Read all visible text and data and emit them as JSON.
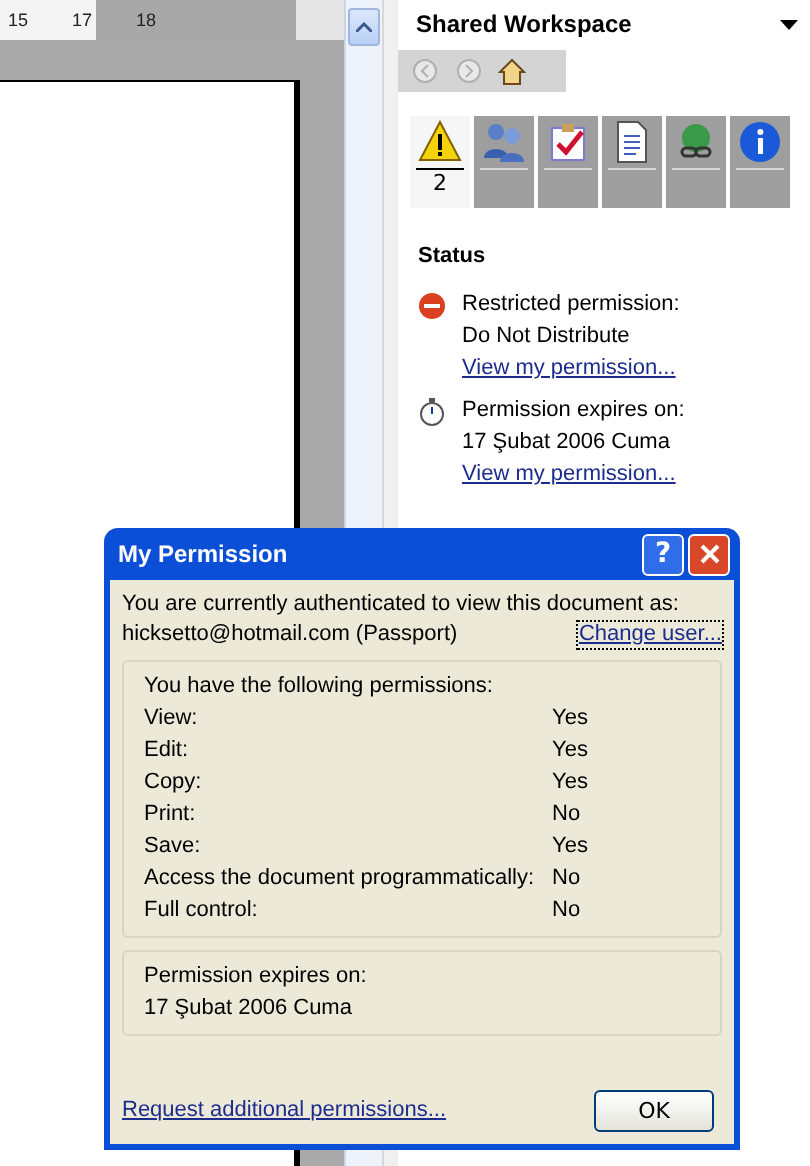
{
  "document": {
    "ruler_labels": [
      "15",
      "17",
      "18"
    ]
  },
  "task_pane": {
    "title": "Shared Workspace",
    "nav_buttons": [
      {
        "kind": "back",
        "disabled": true
      },
      {
        "kind": "forward",
        "disabled": true
      },
      {
        "kind": "home",
        "disabled": false
      }
    ],
    "tabs": [
      {
        "kind": "status",
        "badge": "2",
        "selected": true
      },
      {
        "kind": "members",
        "selected": false
      },
      {
        "kind": "tasks",
        "selected": false
      },
      {
        "kind": "documents",
        "selected": false
      },
      {
        "kind": "links",
        "selected": false
      },
      {
        "kind": "info",
        "selected": false
      }
    ],
    "section_title": "Status",
    "status_items": [
      {
        "kind": "restricted",
        "lines": [
          "Restricted permission:",
          "Do Not Distribute"
        ],
        "link": "View my permission..."
      },
      {
        "kind": "expiry",
        "lines": [
          "Permission expires on:",
          "17 Şubat 2006 Cuma"
        ],
        "link": "View my permission..."
      }
    ]
  },
  "dialog": {
    "title": "My Permission",
    "help": "?",
    "intro": "You are currently authenticated to view this document as:",
    "user": "hicksetto@hotmail.com (Passport)",
    "change_link": "Change user...",
    "permissions_heading": "You have the following permissions:",
    "permissions": [
      {
        "name": "View:",
        "value": "Yes"
      },
      {
        "name": "Edit:",
        "value": "Yes"
      },
      {
        "name": "Copy:",
        "value": "Yes"
      },
      {
        "name": "Print:",
        "value": "No"
      },
      {
        "name": "Save:",
        "value": "Yes"
      },
      {
        "name": "Access the document programmatically:",
        "value": "No"
      },
      {
        "name": "Full control:",
        "value": "No"
      }
    ],
    "expiry_label": "Permission expires on:",
    "expiry_date": "17 Şubat 2006 Cuma",
    "request_link": "Request additional permissions...",
    "ok": "OK"
  }
}
